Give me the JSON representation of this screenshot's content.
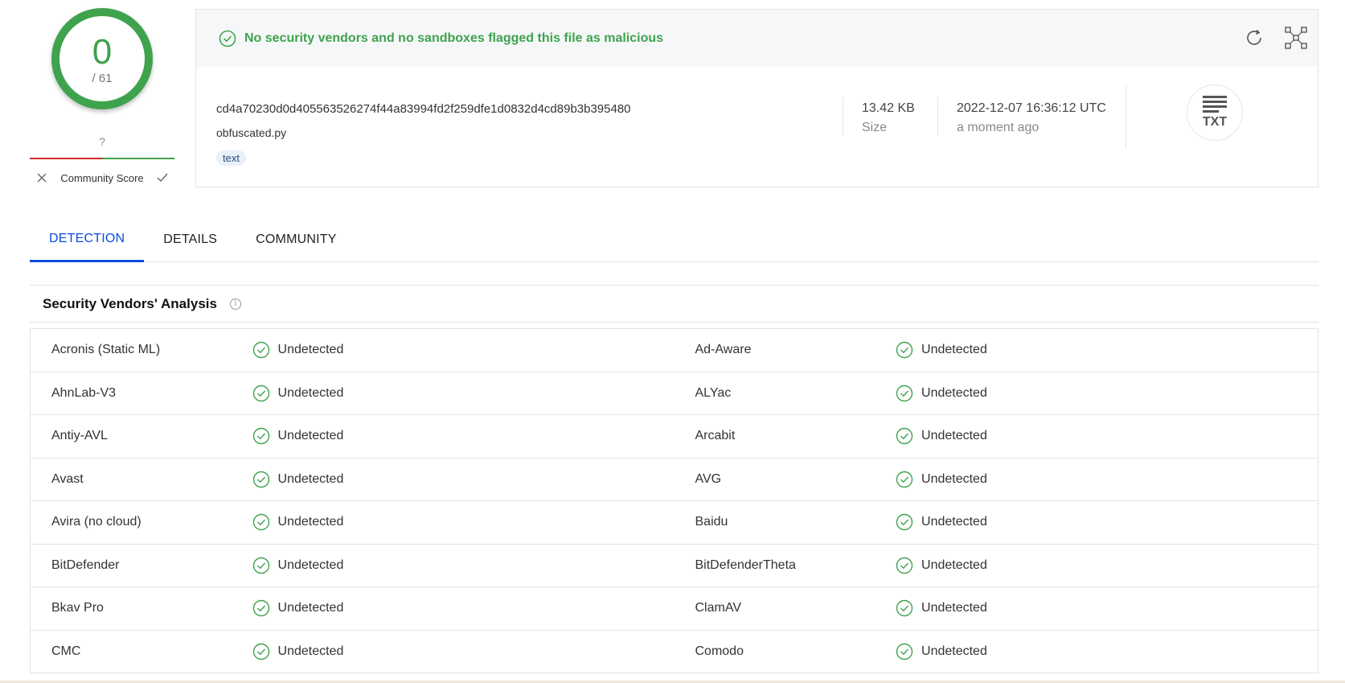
{
  "score": {
    "value": "0",
    "total": "/ 61"
  },
  "community": {
    "question": "?",
    "label": "Community Score"
  },
  "banner": {
    "message": "No security vendors and no sandboxes flagged this file as malicious"
  },
  "file": {
    "hash": "cd4a70230d0d405563526274f44a83994fd2f259dfe1d0832d4cd89b3b395480",
    "name": "obfuscated.py",
    "tag": "text",
    "size": "13.42 KB",
    "size_label": "Size",
    "date": "2022-12-07 16:36:12 UTC",
    "date_relative": "a moment ago",
    "type_label": "TXT"
  },
  "tabs": [
    {
      "label": "DETECTION",
      "active": true
    },
    {
      "label": "DETAILS",
      "active": false
    },
    {
      "label": "COMMUNITY",
      "active": false
    }
  ],
  "section": {
    "title": "Security Vendors' Analysis",
    "info": "i"
  },
  "vendors": [
    {
      "left": "Acronis (Static ML)",
      "left_result": "Undetected",
      "right": "Ad-Aware",
      "right_result": "Undetected"
    },
    {
      "left": "AhnLab-V3",
      "left_result": "Undetected",
      "right": "ALYac",
      "right_result": "Undetected"
    },
    {
      "left": "Antiy-AVL",
      "left_result": "Undetected",
      "right": "Arcabit",
      "right_result": "Undetected"
    },
    {
      "left": "Avast",
      "left_result": "Undetected",
      "right": "AVG",
      "right_result": "Undetected"
    },
    {
      "left": "Avira (no cloud)",
      "left_result": "Undetected",
      "right": "Baidu",
      "right_result": "Undetected"
    },
    {
      "left": "BitDefender",
      "left_result": "Undetected",
      "right": "BitDefenderTheta",
      "right_result": "Undetected"
    },
    {
      "left": "Bkav Pro",
      "left_result": "Undetected",
      "right": "ClamAV",
      "right_result": "Undetected"
    },
    {
      "left": "CMC",
      "left_result": "Undetected",
      "right": "Comodo",
      "right_result": "Undetected"
    }
  ],
  "colors": {
    "clean": "#3fa34d",
    "accent": "#0b4dda",
    "malicious": "#d42b2b"
  },
  "icons": {
    "clean": "check-circle-icon",
    "reanalyze": "refresh-icon",
    "similar": "similar-files-icon",
    "vote_down": "close-icon",
    "vote_up": "check-icon",
    "info": "info-icon",
    "filetype": "txt-file-icon"
  }
}
